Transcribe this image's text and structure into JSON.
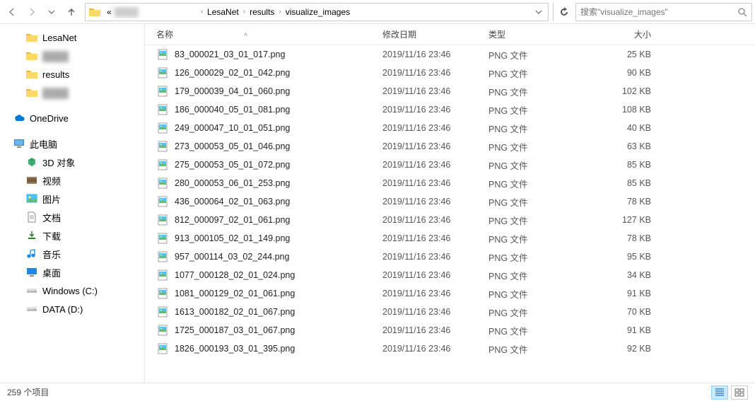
{
  "nav": {
    "breadcrumb": [
      "LesaNet",
      "results",
      "visualize_images"
    ],
    "breadcrumb_prefix": "«"
  },
  "search": {
    "placeholder": "搜索\"visualize_images\"",
    "prefix": "搜索"
  },
  "sidebar": {
    "quick": [
      {
        "label": "LesaNet",
        "type": "folder"
      },
      {
        "label": "",
        "type": "folder",
        "blur": true
      },
      {
        "label": "results",
        "type": "folder"
      },
      {
        "label": "",
        "type": "folder",
        "blur": true
      }
    ],
    "onedrive": {
      "label": "OneDrive"
    },
    "thispc": {
      "label": "此电脑",
      "items": [
        {
          "label": "3D 对象",
          "icon": "3d"
        },
        {
          "label": "视频",
          "icon": "video"
        },
        {
          "label": "图片",
          "icon": "pictures"
        },
        {
          "label": "文档",
          "icon": "documents"
        },
        {
          "label": "下载",
          "icon": "downloads"
        },
        {
          "label": "音乐",
          "icon": "music"
        },
        {
          "label": "桌面",
          "icon": "desktop"
        },
        {
          "label": "Windows (C:)",
          "icon": "drive"
        },
        {
          "label": "DATA (D:)",
          "icon": "drive"
        }
      ]
    }
  },
  "columns": {
    "name": "名称",
    "date": "修改日期",
    "type": "类型",
    "size": "大小"
  },
  "files": [
    {
      "name": "83_000021_03_01_017.png",
      "date": "2019/11/16 23:46",
      "type": "PNG 文件",
      "size": "25 KB"
    },
    {
      "name": "126_000029_02_01_042.png",
      "date": "2019/11/16 23:46",
      "type": "PNG 文件",
      "size": "90 KB"
    },
    {
      "name": "179_000039_04_01_060.png",
      "date": "2019/11/16 23:46",
      "type": "PNG 文件",
      "size": "102 KB"
    },
    {
      "name": "186_000040_05_01_081.png",
      "date": "2019/11/16 23:46",
      "type": "PNG 文件",
      "size": "108 KB"
    },
    {
      "name": "249_000047_10_01_051.png",
      "date": "2019/11/16 23:46",
      "type": "PNG 文件",
      "size": "40 KB"
    },
    {
      "name": "273_000053_05_01_046.png",
      "date": "2019/11/16 23:46",
      "type": "PNG 文件",
      "size": "63 KB"
    },
    {
      "name": "275_000053_05_01_072.png",
      "date": "2019/11/16 23:46",
      "type": "PNG 文件",
      "size": "85 KB"
    },
    {
      "name": "280_000053_06_01_253.png",
      "date": "2019/11/16 23:46",
      "type": "PNG 文件",
      "size": "85 KB"
    },
    {
      "name": "436_000064_02_01_063.png",
      "date": "2019/11/16 23:46",
      "type": "PNG 文件",
      "size": "78 KB"
    },
    {
      "name": "812_000097_02_01_061.png",
      "date": "2019/11/16 23:46",
      "type": "PNG 文件",
      "size": "127 KB"
    },
    {
      "name": "913_000105_02_01_149.png",
      "date": "2019/11/16 23:46",
      "type": "PNG 文件",
      "size": "78 KB"
    },
    {
      "name": "957_000114_03_02_244.png",
      "date": "2019/11/16 23:46",
      "type": "PNG 文件",
      "size": "95 KB"
    },
    {
      "name": "1077_000128_02_01_024.png",
      "date": "2019/11/16 23:46",
      "type": "PNG 文件",
      "size": "34 KB"
    },
    {
      "name": "1081_000129_02_01_061.png",
      "date": "2019/11/16 23:46",
      "type": "PNG 文件",
      "size": "91 KB"
    },
    {
      "name": "1613_000182_02_01_067.png",
      "date": "2019/11/16 23:46",
      "type": "PNG 文件",
      "size": "70 KB"
    },
    {
      "name": "1725_000187_03_01_067.png",
      "date": "2019/11/16 23:46",
      "type": "PNG 文件",
      "size": "91 KB"
    },
    {
      "name": "1826_000193_03_01_395.png",
      "date": "2019/11/16 23:46",
      "type": "PNG 文件",
      "size": "92 KB"
    }
  ],
  "status": {
    "item_count": "259 个项目"
  }
}
